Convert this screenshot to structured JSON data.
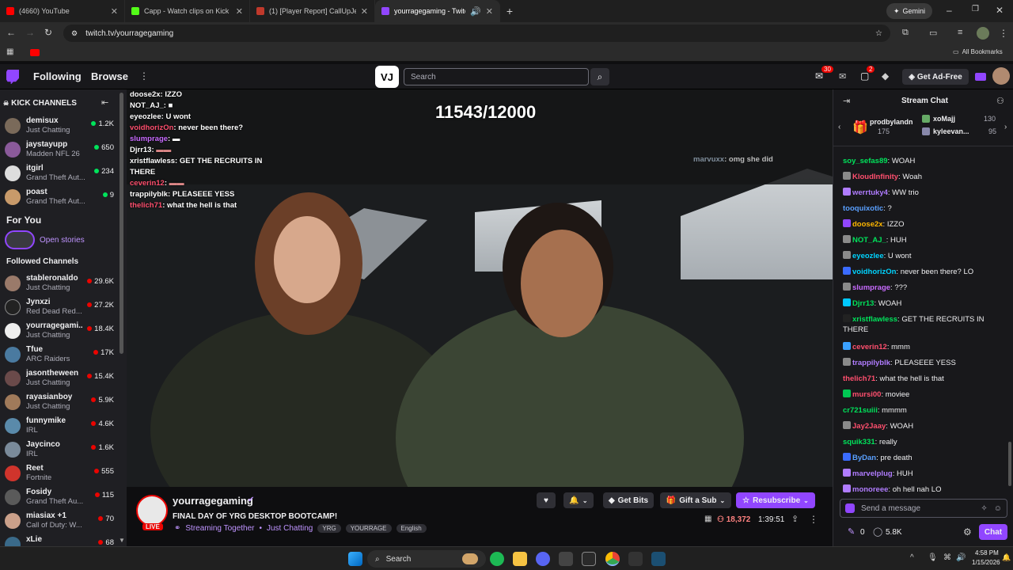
{
  "browser": {
    "tabs": [
      {
        "title": "(4660) YouTube",
        "color": "#ff0000"
      },
      {
        "title": "Capp - Watch clips on Kick",
        "color": "#53fc18"
      },
      {
        "title": "(1) [Player Report] CallUpJefe |",
        "color": "#c0392b"
      },
      {
        "title": "yourragegaming - Twitch",
        "color": "#9146ff"
      }
    ],
    "new_tab": "+",
    "gemini": "Gemini",
    "url": "twitch.tv/yourragegaming",
    "all_bookmarks": "All Bookmarks"
  },
  "nav": {
    "following": "Following",
    "browse": "Browse",
    "search_placeholder": "Search",
    "notif_count": "30",
    "whisper_count": "2",
    "ad_free": "Get Ad-Free"
  },
  "sidebar": {
    "kick_title": "KICK CHANNELS",
    "kick": [
      {
        "name": "demisux",
        "game": "Just Chatting",
        "viewers": "1.2K",
        "dot": "green"
      },
      {
        "name": "jaystayupp",
        "game": "Madden NFL 26",
        "viewers": "650",
        "dot": "green"
      },
      {
        "name": "itgirl",
        "game": "Grand Theft Aut...",
        "viewers": "234",
        "dot": "green"
      },
      {
        "name": "poast",
        "game": "Grand Theft Aut...",
        "viewers": "9",
        "dot": "green"
      }
    ],
    "for_you": "For You",
    "open_stories": "Open stories",
    "followed_title": "Followed Channels",
    "followed": [
      {
        "name": "stableronaldo",
        "game": "Just Chatting",
        "viewers": "29.6K"
      },
      {
        "name": "Jynxzi",
        "game": "Red Dead Red...",
        "viewers": "27.2K"
      },
      {
        "name": "yourragegami...",
        "game": "Just Chatting",
        "viewers": "18.4K"
      },
      {
        "name": "Tfue",
        "game": "ARC Raiders",
        "viewers": "17K"
      },
      {
        "name": "jasontheween",
        "game": "Just Chatting",
        "viewers": "15.4K"
      },
      {
        "name": "rayasianboy",
        "game": "Just Chatting",
        "viewers": "5.9K"
      },
      {
        "name": "funnymike",
        "game": "IRL",
        "viewers": "4.6K"
      },
      {
        "name": "Jaycinco",
        "game": "IRL",
        "viewers": "1.6K"
      },
      {
        "name": "Reet",
        "game": "Fortnite",
        "viewers": "555"
      },
      {
        "name": "Fosidy",
        "game": "Grand Theft Au...",
        "viewers": "115"
      },
      {
        "name": "miasiax +1",
        "game": "Call of Duty: W...",
        "viewers": "70"
      },
      {
        "name": "xLie",
        "game": "",
        "viewers": "68"
      }
    ]
  },
  "video": {
    "counter": "11543/12000",
    "overlay_chat": [
      {
        "user": "doose2x",
        "msg": "IZZO",
        "color": "#ffffff"
      },
      {
        "user": "NOT_AJ_",
        "msg": "",
        "color": "#ffffff"
      },
      {
        "user": "eyeozlee",
        "msg": "U wont",
        "color": "#ffffff"
      },
      {
        "user": "voidhorizOn",
        "msg": "never been there?",
        "color": "#ff4f6e"
      },
      {
        "user": "slumprage",
        "msg": "",
        "color": "#c86bff"
      },
      {
        "user": "Djrr13",
        "msg": "",
        "color": "#ffffff"
      },
      {
        "user": "xristflawless",
        "msg": "GET THE RECRUITS IN THERE",
        "color": "#ffffff"
      },
      {
        "user": "ceverin12",
        "msg": "",
        "color": "#ff4f6e"
      },
      {
        "user": "trappilyblk",
        "msg": "PLEASEEE YESS",
        "color": "#ffffff"
      },
      {
        "user": "thelich71",
        "msg": "what the hell is that",
        "color": "#ff4f6e"
      }
    ],
    "overlay_right": {
      "user": "marvuxx",
      "msg": "omg she did"
    }
  },
  "info": {
    "channel": "yourragegaming",
    "live": "LIVE",
    "title": "FINAL DAY OF YRG DESKTOP BOOTCAMP!",
    "streaming_together": "Streaming Together",
    "category": "Just Chatting",
    "tags": [
      "YRG",
      "YOURRAGE",
      "English"
    ],
    "get_bits": "Get Bits",
    "gift_sub": "Gift a Sub",
    "resubscribe": "Resubscribe",
    "viewers": "18,372",
    "uptime": "1:39:51"
  },
  "chat": {
    "header": "Stream Chat",
    "gifters": [
      {
        "name": "prodbylandn",
        "count": "175"
      },
      {
        "name": "xoMajj",
        "count": "130"
      },
      {
        "name": "kyleevan...",
        "count": "95"
      }
    ],
    "messages": [
      {
        "user": "soy_sefas89",
        "msg": "WOAH",
        "color": "#00e35b",
        "badge": ""
      },
      {
        "user": "KloudInfinity",
        "msg": "Woah",
        "color": "#ff4f6e",
        "badge": "#8a8a8a"
      },
      {
        "user": "werrtuky4",
        "msg": "WW trio",
        "color": "#b07cff",
        "badge": "#b07cff"
      },
      {
        "user": "tooquixotic",
        "msg": "?",
        "color": "#5aa0ff",
        "badge": ""
      },
      {
        "user": "doose2x",
        "msg": "IZZO",
        "color": "#ffb700",
        "badge": "#9146ff"
      },
      {
        "user": "NOT_AJ_",
        "msg": "HUH",
        "color": "#00e35b",
        "badge": "#8a8a8a"
      },
      {
        "user": "eyeozlee",
        "msg": "U wont",
        "color": "#00d4ff",
        "badge": "#8a8a8a"
      },
      {
        "user": "voidhorizOn",
        "msg": "never been there? LO",
        "color": "#00d4ff",
        "badge": "#3a6bff"
      },
      {
        "user": "slumprage",
        "msg": "???",
        "color": "#c86bff",
        "badge": "#8a8a8a"
      },
      {
        "user": "Djrr13",
        "msg": "WOAH",
        "color": "#00e35b",
        "badge": "#00c8ff"
      },
      {
        "user": "xristflawless",
        "msg": "GET THE RECRUITS IN THERE",
        "color": "#00e35b",
        "badge": "#222"
      },
      {
        "user": "ceverin12",
        "msg": "mmm",
        "color": "#ff4f6e",
        "badge": "#3aa0ff"
      },
      {
        "user": "trappilyblk",
        "msg": "PLEASEEE YESS",
        "color": "#b07cff",
        "badge": "#8a8a8a"
      },
      {
        "user": "thelich71",
        "msg": "what the hell is that",
        "color": "#ff4f6e",
        "badge": ""
      },
      {
        "user": "mursi00",
        "msg": "moviee",
        "color": "#ff4f6e",
        "badge": "#00c853"
      },
      {
        "user": "cr721suiii",
        "msg": "mmmm",
        "color": "#00e35b",
        "badge": ""
      },
      {
        "user": "Jay2Jaay",
        "msg": "WOAH",
        "color": "#ff4f6e",
        "badge": "#8a8a8a"
      },
      {
        "user": "squik331",
        "msg": "really",
        "color": "#00e35b",
        "badge": ""
      },
      {
        "user": "ByDan",
        "msg": "pre death",
        "color": "#5aa0ff",
        "badge": "#3a6bff"
      },
      {
        "user": "marvelplug",
        "msg": "HUH",
        "color": "#b07cff",
        "badge": "#b07cff"
      },
      {
        "user": "monoreee",
        "msg": "oh hell nah LO",
        "color": "#b07cff",
        "badge": "#b07cff"
      }
    ],
    "placeholder": "Send a message",
    "bits": "0",
    "points": "5.8K",
    "chat_button": "Chat"
  },
  "taskbar": {
    "search": "Search",
    "time": "4:58 PM",
    "date": "1/15/2026"
  }
}
